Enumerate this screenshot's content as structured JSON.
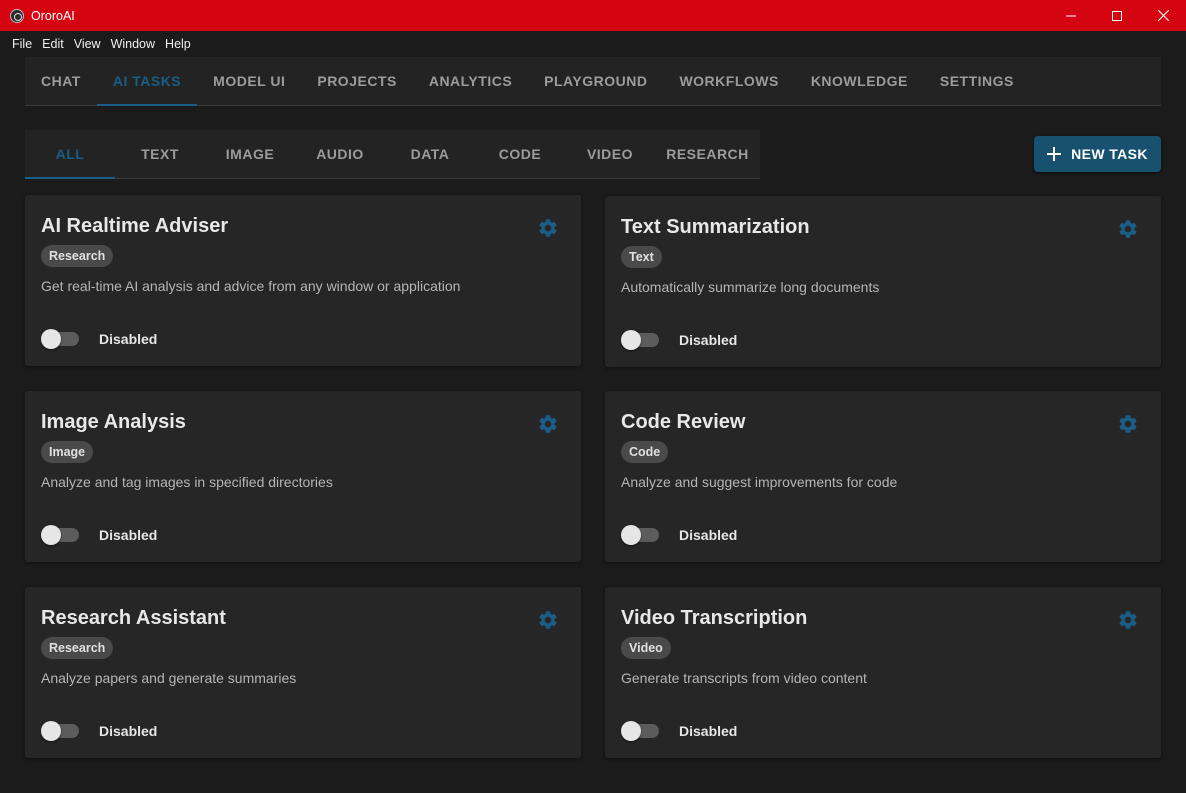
{
  "window": {
    "title": "OroroAI",
    "controls": [
      "minimize-icon",
      "maximize-icon",
      "close-icon"
    ]
  },
  "menubar": {
    "items": [
      "File",
      "Edit",
      "View",
      "Window",
      "Help"
    ]
  },
  "main_tabs": {
    "items": [
      "CHAT",
      "AI TASKS",
      "MODEL UI",
      "PROJECTS",
      "ANALYTICS",
      "PLAYGROUND",
      "WORKFLOWS",
      "KNOWLEDGE",
      "SETTINGS"
    ],
    "active": "AI TASKS"
  },
  "sub_tabs": {
    "items": [
      "ALL",
      "TEXT",
      "IMAGE",
      "AUDIO",
      "DATA",
      "CODE",
      "VIDEO",
      "RESEARCH"
    ],
    "active": "ALL"
  },
  "new_task_button": {
    "label": "NEW TASK",
    "icon": "plus-icon"
  },
  "colors": {
    "titlebar": "#d40511",
    "accent": "#1a5d86",
    "button": "#17516f",
    "background": "#1b1b1b",
    "card": "#262626"
  },
  "tasks": [
    {
      "title": "AI Realtime Adviser",
      "category": "Research",
      "description": "Get real-time AI analysis and advice from any window or application",
      "status": "Disabled",
      "enabled": false
    },
    {
      "title": "Text Summarization",
      "category": "Text",
      "description": "Automatically summarize long documents",
      "status": "Disabled",
      "enabled": false
    },
    {
      "title": "Image Analysis",
      "category": "Image",
      "description": "Analyze and tag images in specified directories",
      "status": "Disabled",
      "enabled": false
    },
    {
      "title": "Code Review",
      "category": "Code",
      "description": "Analyze and suggest improvements for code",
      "status": "Disabled",
      "enabled": false
    },
    {
      "title": "Research Assistant",
      "category": "Research",
      "description": "Analyze papers and generate summaries",
      "status": "Disabled",
      "enabled": false
    },
    {
      "title": "Video Transcription",
      "category": "Video",
      "description": "Generate transcripts from video content",
      "status": "Disabled",
      "enabled": false
    }
  ]
}
